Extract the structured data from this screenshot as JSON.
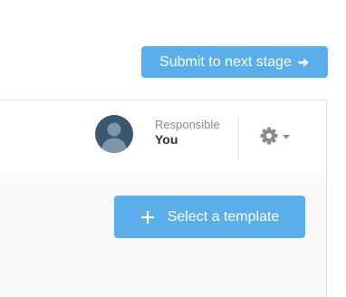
{
  "colors": {
    "accent": "#5aaeea",
    "panel_body_bg": "#fcf9fb",
    "border": "#dcdcdc",
    "avatar_bg": "#3a5770",
    "icon_gray": "#8a8a8a"
  },
  "toolbar": {
    "submit_label": "Submit to next stage",
    "submit_icon": "arrow-right-icon"
  },
  "header": {
    "avatar_icon": "user-avatar-icon",
    "responsible_label": "Responsible",
    "responsible_value": "You",
    "settings_icon": "gear-icon",
    "settings_caret_icon": "caret-down-icon"
  },
  "body": {
    "template_label": "Select a template",
    "template_icon": "plus-icon"
  }
}
